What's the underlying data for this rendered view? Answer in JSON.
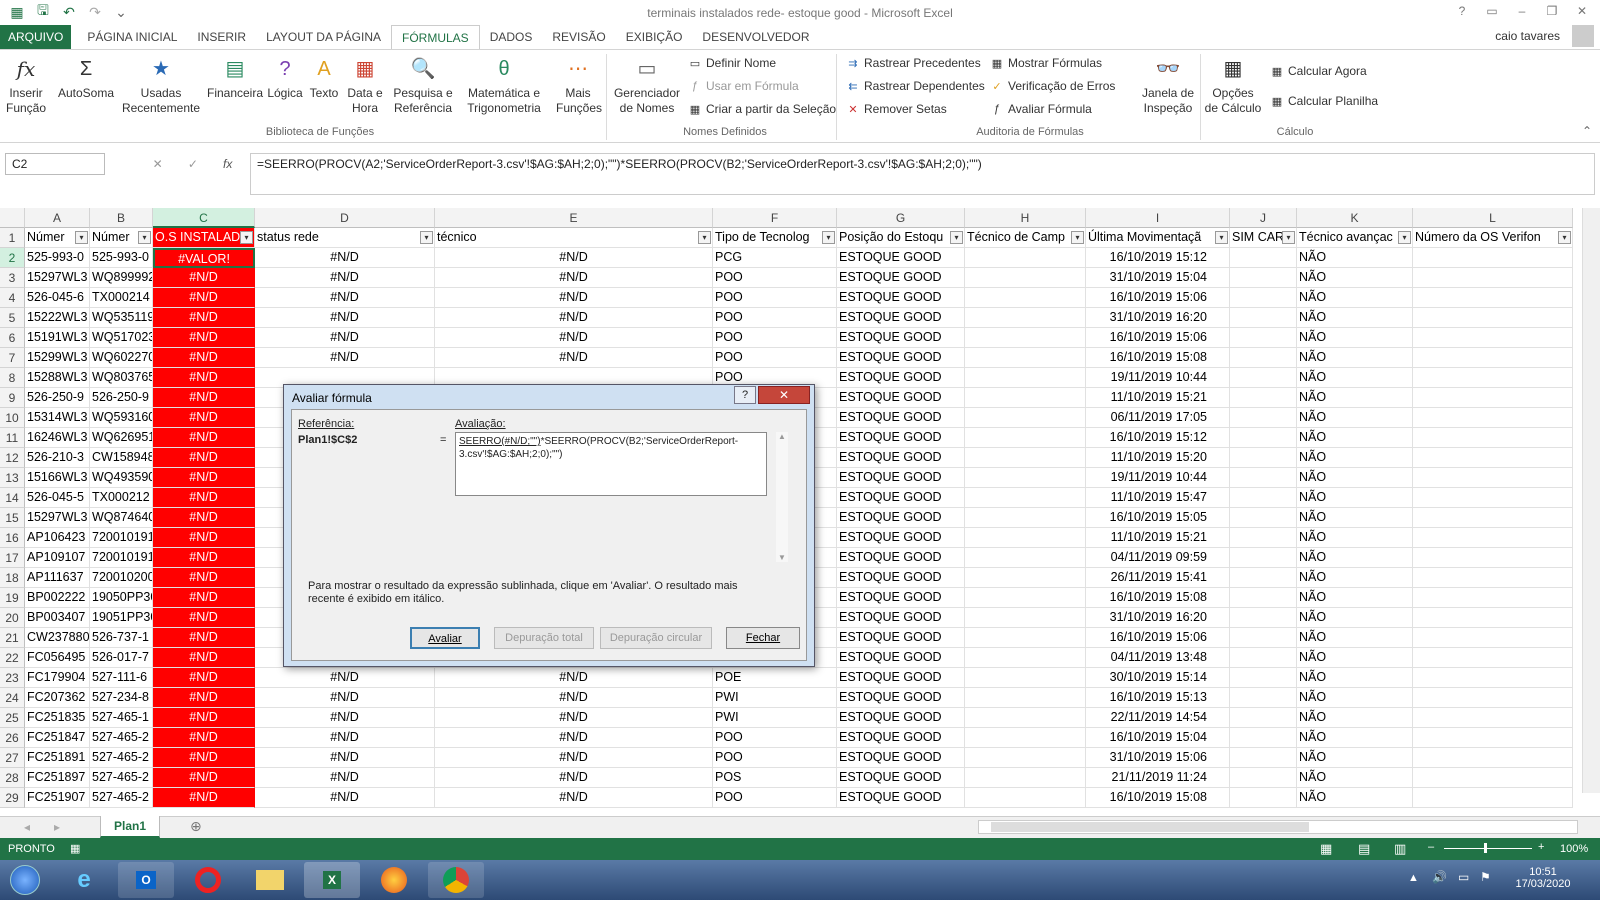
{
  "window": {
    "title": "terminais instalados rede- estoque good - Microsoft Excel",
    "user": "caio tavares"
  },
  "tabs": [
    "ARQUIVO",
    "PÁGINA INICIAL",
    "INSERIR",
    "LAYOUT DA PÁGINA",
    "FÓRMULAS",
    "DADOS",
    "REVISÃO",
    "EXIBIÇÃO",
    "DESENVOLVEDOR"
  ],
  "ribbon": {
    "inserir_funcao": "Inserir Função",
    "autosoma": "AutoSoma",
    "usadas": "Usadas Recentemente",
    "financeira": "Financeira",
    "logica": "Lógica",
    "texto": "Texto",
    "data_hora": "Data e Hora",
    "pesquisa": "Pesquisa e Referência",
    "matematica": "Matemática e Trigonometria",
    "mais": "Mais Funções",
    "group_biblioteca": "Biblioteca de Funções",
    "gerenciador": "Gerenciador de Nomes",
    "definir_nome": "Definir Nome",
    "usar_formula": "Usar em Fórmula",
    "criar_selecao": "Criar a partir da Seleção",
    "group_nomes": "Nomes Definidos",
    "rastrear_prec": "Rastrear Precedentes",
    "rastrear_dep": "Rastrear Dependentes",
    "remover_setas": "Remover Setas",
    "mostrar_formulas": "Mostrar Fórmulas",
    "verificacao_erros": "Verificação de Erros",
    "avaliar_formula": "Avaliar Fórmula",
    "janela": "Janela de Inspeção",
    "group_auditoria": "Auditoria de Fórmulas",
    "opcoes_calculo": "Opções de Cálculo",
    "calcular_agora": "Calcular Agora",
    "calcular_planilha": "Calcular Planilha",
    "group_calculo": "Cálculo"
  },
  "formula_bar": {
    "name_box": "C2",
    "formula": "=SEERRO(PROCV(A2;'ServiceOrderReport-3.csv'!$AG:$AH;2;0);\"\")*SEERRO(PROCV(B2;'ServiceOrderReport-3.csv'!$AG:$AH;2;0);\"\")"
  },
  "columns": [
    "A",
    "B",
    "C",
    "D",
    "E",
    "F",
    "G",
    "H",
    "I",
    "J",
    "K",
    "L"
  ],
  "headers": [
    "Númer",
    "Númer",
    "O.S INSTALAD",
    "status rede",
    "técnico",
    "Tipo de Tecnolog",
    "Posição do Estoqu",
    "Técnico de Camp",
    "Última Movimentaçã",
    "SIM CAR",
    "Técnico avançac",
    "Número da OS Verifon"
  ],
  "rows": [
    [
      "525-993-0",
      "525-993-0",
      "#VALOR!",
      "#N/D",
      "#N/D",
      "PCG",
      "ESTOQUE GOOD",
      "",
      "16/10/2019 15:12",
      "",
      "NÃO",
      ""
    ],
    [
      "15297WL3",
      "WQ899992",
      "#N/D",
      "#N/D",
      "#N/D",
      "POO",
      "ESTOQUE GOOD",
      "",
      "31/10/2019 15:04",
      "",
      "NÃO",
      ""
    ],
    [
      "526-045-6",
      "TX000214",
      "#N/D",
      "#N/D",
      "#N/D",
      "POO",
      "ESTOQUE GOOD",
      "",
      "16/10/2019 15:06",
      "",
      "NÃO",
      ""
    ],
    [
      "15222WL3",
      "WQ535119",
      "#N/D",
      "#N/D",
      "#N/D",
      "POO",
      "ESTOQUE GOOD",
      "",
      "31/10/2019 16:20",
      "",
      "NÃO",
      ""
    ],
    [
      "15191WL3",
      "WQ517023",
      "#N/D",
      "#N/D",
      "#N/D",
      "POO",
      "ESTOQUE GOOD",
      "",
      "16/10/2019 15:06",
      "",
      "NÃO",
      ""
    ],
    [
      "15299WL3",
      "WQ602270",
      "#N/D",
      "#N/D",
      "#N/D",
      "POO",
      "ESTOQUE GOOD",
      "",
      "16/10/2019 15:08",
      "",
      "NÃO",
      ""
    ],
    [
      "15288WL3",
      "WQ803765",
      "#N/D",
      "",
      "",
      "POO",
      "ESTOQUE GOOD",
      "",
      "19/11/2019 10:44",
      "",
      "NÃO",
      ""
    ],
    [
      "526-250-9",
      "526-250-9",
      "#N/D",
      "",
      "",
      "",
      "ESTOQUE GOOD",
      "",
      "11/10/2019 15:21",
      "",
      "NÃO",
      ""
    ],
    [
      "15314WL3",
      "WQ593160",
      "#N/D",
      "",
      "",
      "",
      "ESTOQUE GOOD",
      "",
      "06/11/2019 17:05",
      "",
      "NÃO",
      ""
    ],
    [
      "16246WL3",
      "WQ626951",
      "#N/D",
      "",
      "",
      "",
      "ESTOQUE GOOD",
      "",
      "16/10/2019 15:12",
      "",
      "NÃO",
      ""
    ],
    [
      "526-210-3",
      "CW158948",
      "#N/D",
      "",
      "",
      "",
      "ESTOQUE GOOD",
      "",
      "11/10/2019 15:20",
      "",
      "NÃO",
      ""
    ],
    [
      "15166WL3",
      "WQ493590",
      "#N/D",
      "",
      "",
      "",
      "ESTOQUE GOOD",
      "",
      "19/11/2019 10:44",
      "",
      "NÃO",
      ""
    ],
    [
      "526-045-5",
      "TX000212",
      "#N/D",
      "",
      "",
      "",
      "ESTOQUE GOOD",
      "",
      "11/10/2019 15:47",
      "",
      "NÃO",
      ""
    ],
    [
      "15297WL3",
      "WQ874640",
      "#N/D",
      "",
      "",
      "",
      "ESTOQUE GOOD",
      "",
      "16/10/2019 15:05",
      "",
      "NÃO",
      ""
    ],
    [
      "AP106423",
      "720010191",
      "#N/D",
      "",
      "",
      "",
      "ESTOQUE GOOD",
      "",
      "11/10/2019 15:21",
      "",
      "NÃO",
      ""
    ],
    [
      "AP109107",
      "720010191",
      "#N/D",
      "",
      "",
      "",
      "ESTOQUE GOOD",
      "",
      "04/11/2019 09:59",
      "",
      "NÃO",
      ""
    ],
    [
      "AP111637",
      "720010200",
      "#N/D",
      "",
      "",
      "",
      "ESTOQUE GOOD",
      "",
      "26/11/2019 15:41",
      "",
      "NÃO",
      ""
    ],
    [
      "BP002222",
      "19050PP30",
      "#N/D",
      "",
      "",
      "",
      "ESTOQUE GOOD",
      "",
      "16/10/2019 15:08",
      "",
      "NÃO",
      ""
    ],
    [
      "BP003407",
      "19051PP30",
      "#N/D",
      "",
      "",
      "",
      "ESTOQUE GOOD",
      "",
      "31/10/2019 16:20",
      "",
      "NÃO",
      ""
    ],
    [
      "CW237880",
      "526-737-1",
      "#N/D",
      "",
      "",
      "",
      "ESTOQUE GOOD",
      "",
      "16/10/2019 15:06",
      "",
      "NÃO",
      ""
    ],
    [
      "FC056495",
      "526-017-7",
      "#N/D",
      "",
      "",
      "",
      "ESTOQUE GOOD",
      "",
      "04/11/2019 13:48",
      "",
      "NÃO",
      ""
    ],
    [
      "FC179904",
      "527-111-6",
      "#N/D",
      "#N/D",
      "#N/D",
      "POE",
      "ESTOQUE GOOD",
      "",
      "30/10/2019 15:14",
      "",
      "NÃO",
      ""
    ],
    [
      "FC207362",
      "527-234-8",
      "#N/D",
      "#N/D",
      "#N/D",
      "PWI",
      "ESTOQUE GOOD",
      "",
      "16/10/2019 15:13",
      "",
      "NÃO",
      ""
    ],
    [
      "FC251835",
      "527-465-1",
      "#N/D",
      "#N/D",
      "#N/D",
      "PWI",
      "ESTOQUE GOOD",
      "",
      "22/11/2019 14:54",
      "",
      "NÃO",
      ""
    ],
    [
      "FC251847",
      "527-465-2",
      "#N/D",
      "#N/D",
      "#N/D",
      "POO",
      "ESTOQUE GOOD",
      "",
      "16/10/2019 15:04",
      "",
      "NÃO",
      ""
    ],
    [
      "FC251891",
      "527-465-2",
      "#N/D",
      "#N/D",
      "#N/D",
      "POO",
      "ESTOQUE GOOD",
      "",
      "31/10/2019 15:06",
      "",
      "NÃO",
      ""
    ],
    [
      "FC251897",
      "527-465-2",
      "#N/D",
      "#N/D",
      "#N/D",
      "POS",
      "ESTOQUE GOOD",
      "",
      "21/11/2019 11:24",
      "",
      "NÃO",
      ""
    ],
    [
      "FC251907",
      "527-465-2",
      "#N/D",
      "#N/D",
      "#N/D",
      "POO",
      "ESTOQUE GOOD",
      "",
      "16/10/2019 15:08",
      "",
      "NÃO",
      ""
    ]
  ],
  "sheet": {
    "tab": "Plan1"
  },
  "status": {
    "mode": "PRONTO",
    "zoom": "100%"
  },
  "dialog": {
    "title": "Avaliar fórmula",
    "ref_label": "Referência:",
    "ref_value": "Plan1!$C$2",
    "eq": "=",
    "eval_label": "Avaliação:",
    "eval_underlined": "SEERRO(#N/D;\"\")",
    "eval_rest": "*SEERRO(PROCV(B2;'ServiceOrderReport-3.csv'!$AG:$AH;2;0);\"\")",
    "help_text": "Para mostrar o resultado da expressão sublinhada, clique em 'Avaliar'. O resultado mais recente é exibido em itálico.",
    "btn_avaliar": "Avaliar",
    "btn_dep_total": "Depuração total",
    "btn_dep_circ": "Depuração circular",
    "btn_fechar": "Fechar"
  },
  "taskbar": {
    "time": "10:51",
    "date": "17/03/2020"
  },
  "colors": {
    "excel_green": "#217346",
    "error_fill": "#ff0000"
  }
}
